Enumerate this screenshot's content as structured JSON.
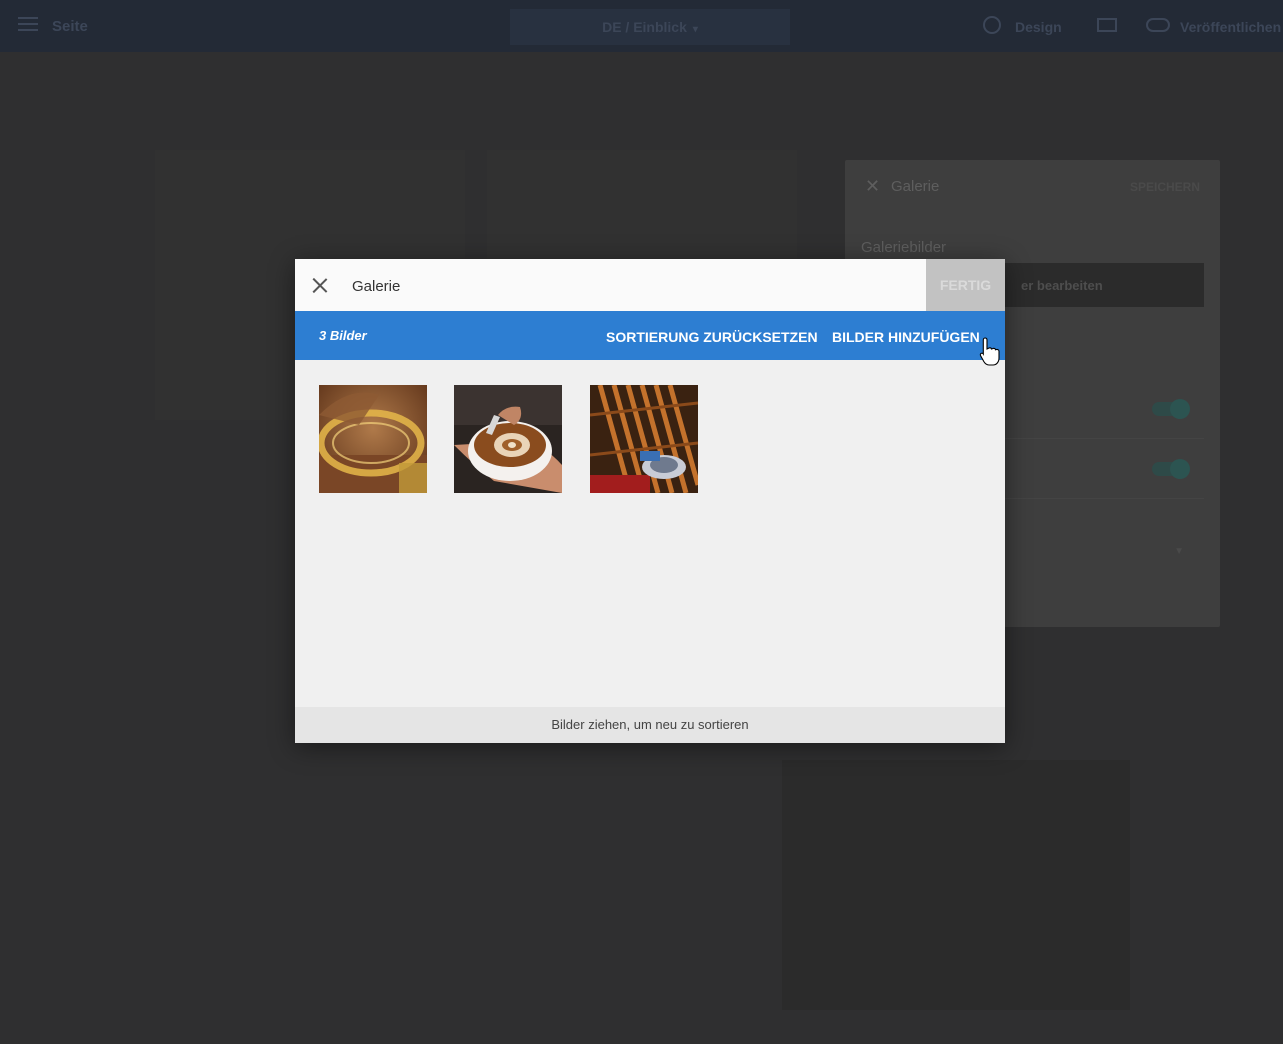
{
  "topbar": {
    "page_label": "Seite",
    "language_selector": "DE / Einblick",
    "design_label": "Design",
    "publish_label": "Veröffentlichen"
  },
  "side_panel": {
    "title": "Galerie",
    "save_label": "SPEICHERN",
    "section_label": "Galeriebilder",
    "edit_button_partial": "er bearbeiten"
  },
  "modal": {
    "title": "Galerie",
    "done_label": "FERTIG",
    "image_count": "3 Bilder",
    "reset_sort_label": "SORTIERUNG ZURÜCKSETZEN",
    "add_images_label": "BILDER HINZUFÜGEN",
    "footer_hint": "Bilder ziehen, um neu zu sortieren",
    "images": [
      {
        "name": "cocoa-powder"
      },
      {
        "name": "latte-art"
      },
      {
        "name": "bench-with-cup"
      }
    ]
  },
  "colors": {
    "toolbar_blue": "#2d7ed2",
    "overlay": "#2f2f30"
  }
}
